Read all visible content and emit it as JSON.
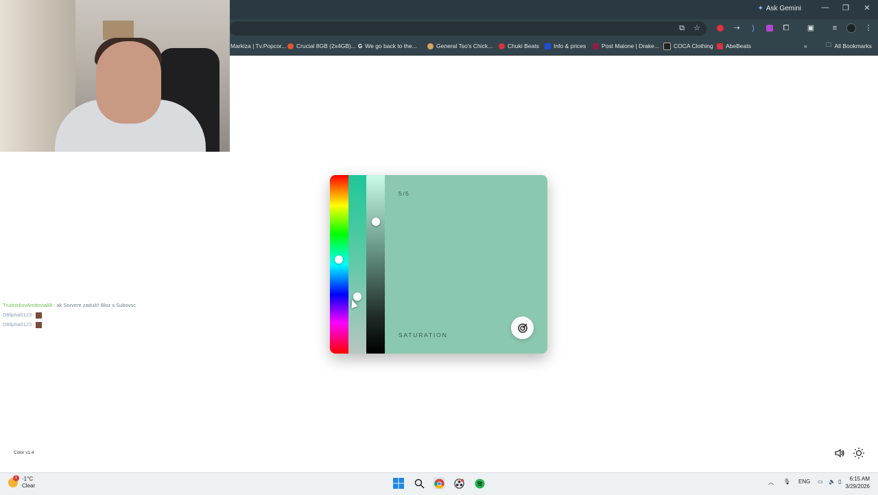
{
  "browser": {
    "ask_gemini": "Ask Gemini",
    "bookmarks": [
      {
        "label": "Markiza | Tv.Popcor...",
        "color": "#c3ccd0"
      },
      {
        "label": "Crucial 8GB (2x4GB)...",
        "color": "#e2562d"
      },
      {
        "label": "We go back to the...",
        "color": "#ffffff"
      },
      {
        "label": "General Tso's Chick...",
        "color": "#d8a55a"
      },
      {
        "label": "Chuki Beats",
        "color": "#d8323c"
      },
      {
        "label": "Info & prices",
        "color": "#1d4fd8"
      },
      {
        "label": "Post Malone | Drake...",
        "color": "#8b1f4a"
      },
      {
        "label": "COCA Clothing",
        "color": "#222222"
      },
      {
        "label": "AbeBeats",
        "color": "#d8323c"
      }
    ],
    "all_bookmarks": "All Bookmarks"
  },
  "chat": [
    {
      "user": "TrudnirkovAmitovia88",
      "message": ": ak Sorvere zaduži! Bloz s Subovsc"
    },
    {
      "user": "D8lipha0123",
      "message": ":"
    },
    {
      "user": "D8lipha0123",
      "message": ":"
    }
  ],
  "picker": {
    "counter": "5/5",
    "label": "SATURATION",
    "color": "#8bc8b0",
    "hue_level": 0.47,
    "saturation_level": 0.69,
    "lightness_level": 0.25
  },
  "footer": {
    "version": "Color v1.4"
  },
  "taskbar": {
    "weather_temp": "-1°C",
    "weather_desc": "Clear",
    "weather_badge": "1",
    "lang": "ENG",
    "time": "6:15 AM",
    "date": "3/29/2026"
  }
}
